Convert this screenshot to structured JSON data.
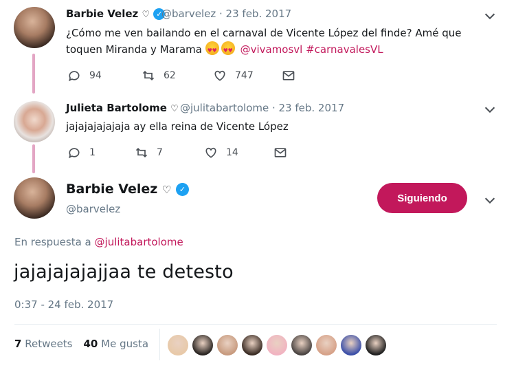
{
  "colors": {
    "accent": "#c2185b",
    "verified": "#1da1f2",
    "muted": "#657786"
  },
  "tweet1": {
    "name": "Barbie Velez",
    "name_heart": "♡",
    "handle_date": "@barvelez · 23 feb. 2017",
    "line1": "¿Cómo me ven bailando en el carnaval de Vicente López del finde? Amé que",
    "line2_plain": "toquen Miranda y Marama",
    "mention": "@vivamosvl",
    "hashtag": "#carnavalesVL",
    "emoji": "heart-eyes-emoji",
    "replies": "94",
    "retweets": "62",
    "likes": "747"
  },
  "tweet2": {
    "name": "Julieta Bartolome",
    "name_heart": "♡",
    "handle_date": "@julitabartolome · 23 feb. 2017",
    "text": "jajajajajajaja ay ella reina de Vicente López",
    "replies": "1",
    "retweets": "7",
    "likes": "14"
  },
  "main": {
    "name": "Barbie Velez",
    "name_heart": "♡",
    "handle": "@barvelez",
    "follow_label": "Siguiendo",
    "reply_prefix": "En respuesta a",
    "reply_to": "@julitabartolome",
    "text": "jajajajajajjaa te detesto",
    "timestamp": "0:37 - 24 feb. 2017"
  },
  "stats": {
    "retweets_count": "7",
    "retweets_label": "Retweets",
    "likes_count": "40",
    "likes_label": "Me gusta"
  },
  "likers": [
    "#e8c9a8",
    "#2a2522",
    "#c79a7e",
    "#3a2c24",
    "#f1b3c1",
    "#4a4442",
    "#d6a188",
    "#3b4fa8",
    "#1f1f1f"
  ]
}
